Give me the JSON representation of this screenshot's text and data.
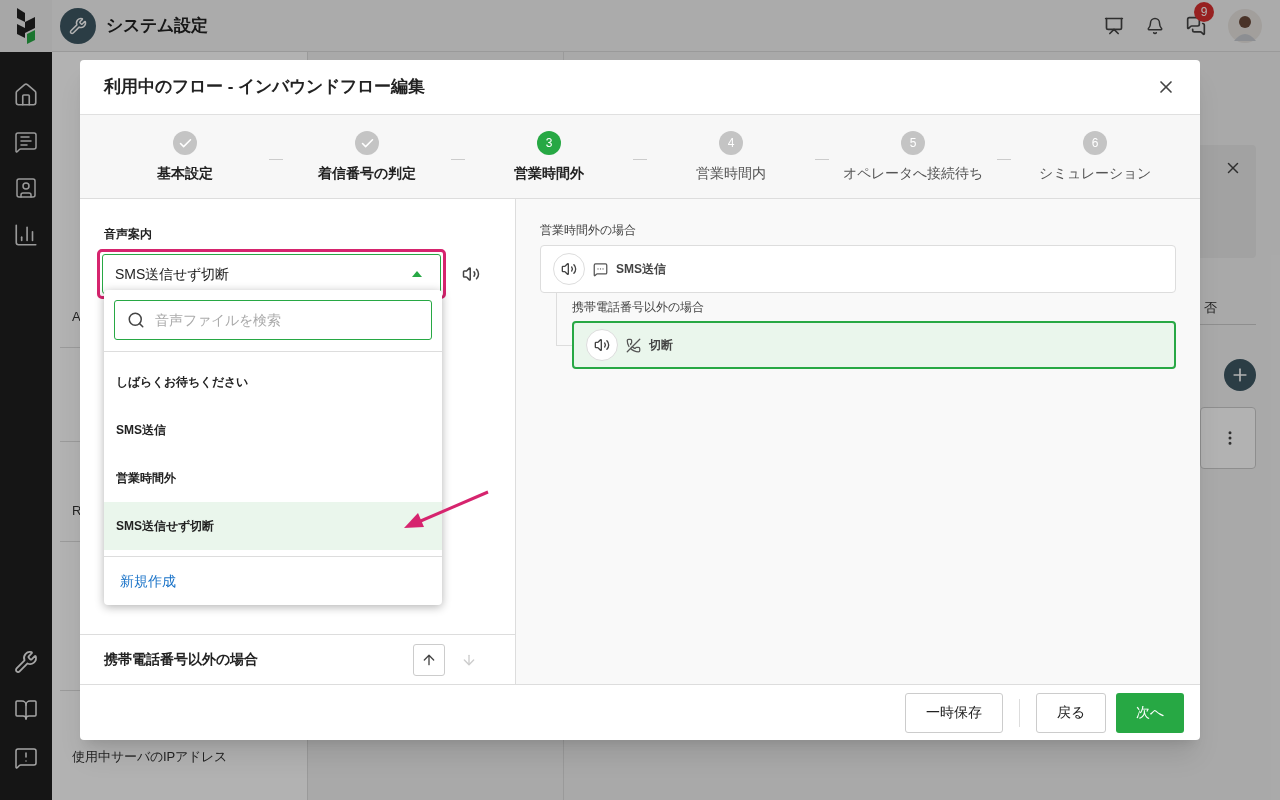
{
  "app": {
    "title": "システム設定",
    "notification_count": "9"
  },
  "background": {
    "sidebar_items": [
      {
        "text": "A"
      },
      {
        "text": "R"
      },
      {
        "text": "使用中サーバのIPアドレス"
      }
    ],
    "column_header": "否"
  },
  "modal": {
    "title": "利用中のフロー - インバウンドフロー編集",
    "steps": [
      {
        "label": "基本設定",
        "done": true,
        "selected": false
      },
      {
        "label": "着信番号の判定",
        "done": true,
        "selected": false
      },
      {
        "number": "3",
        "label": "営業時間外",
        "done": false,
        "selected": true
      },
      {
        "number": "4",
        "label": "営業時間内",
        "done": false,
        "selected": false
      },
      {
        "number": "5",
        "label": "オペレータへ接続待ち",
        "done": false,
        "selected": false
      },
      {
        "number": "6",
        "label": "シミュレーション",
        "done": false,
        "selected": false
      }
    ],
    "voice_select": {
      "label": "音声案内",
      "value": "SMS送信せず切断",
      "expanded": true,
      "search": {
        "placeholder": "音声ファイルを検索"
      },
      "options": [
        {
          "label": "しばらくお待ちください",
          "selected": false
        },
        {
          "label": "SMS送信",
          "selected": false
        },
        {
          "label": "営業時間外",
          "selected": false
        },
        {
          "label": "SMS送信せず切断",
          "selected": true
        }
      ],
      "create_link": "新規作成"
    },
    "section": {
      "title": "携帯電話番号以外の場合",
      "move_up": {
        "disabled": false
      },
      "move_down": {
        "disabled": true
      }
    },
    "flow": {
      "label": "営業時間外の場合",
      "node": {
        "kind": "sms",
        "text": "SMS送信",
        "selected": false
      },
      "children": [
        {
          "label": "携帯電話番号以外の場合",
          "node": {
            "kind": "hangup",
            "text": "切断",
            "selected": true
          }
        }
      ]
    },
    "buttons": [
      {
        "label": "一時保存",
        "kind": "secondary"
      },
      {
        "label": "戻る",
        "kind": "secondary"
      },
      {
        "label": "次へ",
        "kind": "primary"
      }
    ]
  }
}
